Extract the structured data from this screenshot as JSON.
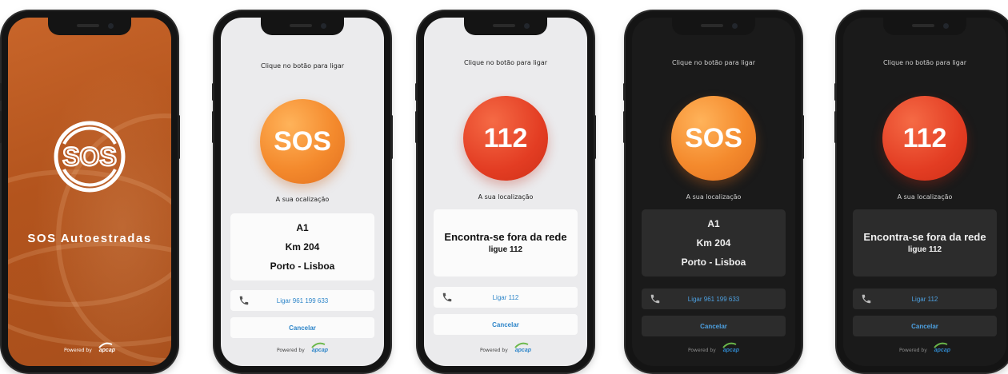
{
  "splash": {
    "title": "SOS Autoestradas",
    "powered_by": "Powered by",
    "brand": "apcap"
  },
  "screens": [
    {
      "instruction": "Clique no botão para ligar",
      "button_label": "SOS",
      "location_label": "A sua ocalização",
      "location": {
        "road": "A1",
        "km": "Km 204",
        "route": "Porto - Lisboa"
      },
      "call_label": "Ligar 961 199 633",
      "cancel_label": "Cancelar",
      "powered_by": "Powered by",
      "brand": "apcap"
    },
    {
      "instruction": "Clique no botão para ligar",
      "button_label": "112",
      "location_label": "A sua localização",
      "out_of_network": {
        "title": "Encontra-se fora da rede",
        "subtitle": "ligue 112"
      },
      "call_label": "Ligar 112",
      "cancel_label": "Cancelar",
      "powered_by": "Powered by",
      "brand": "apcap"
    },
    {
      "instruction": "Clique no botão para ligar",
      "button_label": "SOS",
      "location_label": "A sua localização",
      "location": {
        "road": "A1",
        "km": "Km 204",
        "route": "Porto - Lisboa"
      },
      "call_label": "Ligar 961 199 633",
      "cancel_label": "Cancelar",
      "powered_by": "Powered by",
      "brand": "apcap"
    },
    {
      "instruction": "Clique no botão para ligar",
      "button_label": "112",
      "location_label": "A sua localização",
      "out_of_network": {
        "title": "Encontra-se fora da rede",
        "subtitle": "ligue 112"
      },
      "call_label": "Ligar 112",
      "cancel_label": "Cancelar",
      "powered_by": "Powered by",
      "brand": "apcap"
    }
  ],
  "colors": {
    "sos_orange": "#f48a2d",
    "emergency_red": "#e33d23",
    "link_blue": "#2f86c9",
    "splash_orange": "#b3541d",
    "light_bg": "#ebebed",
    "dark_bg": "#1a1a1a"
  },
  "icons": [
    "sos-logo-icon",
    "phone-icon",
    "apcap-logo-icon"
  ]
}
